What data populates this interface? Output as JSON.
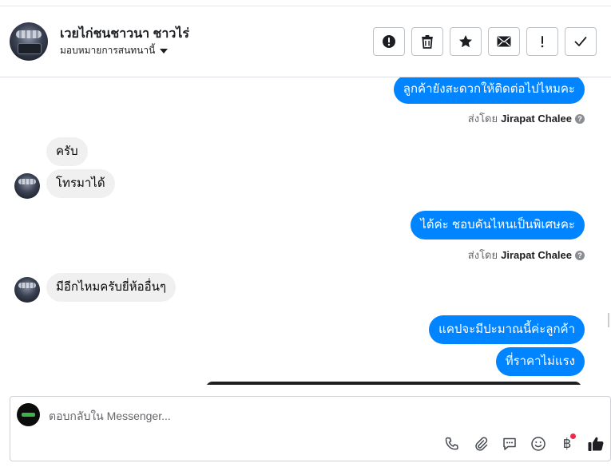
{
  "header": {
    "contact_name": "เวยไก่ชนชาวนา ชาวไร่",
    "assign_label": "มอบหมายการสนทนานี้"
  },
  "toolbar": {
    "buttons": [
      {
        "name": "mark-spam-button",
        "icon": "alert-circle-icon"
      },
      {
        "name": "delete-button",
        "icon": "trash-icon"
      },
      {
        "name": "star-button",
        "icon": "star-icon"
      },
      {
        "name": "mark-unread-button",
        "icon": "envelope-icon"
      },
      {
        "name": "follow-up-button",
        "icon": "exclamation-icon"
      },
      {
        "name": "mark-done-button",
        "icon": "check-icon"
      }
    ]
  },
  "messages": [
    {
      "direction": "out",
      "text": "ลูกค้ายังสะดวกให้ติดต่อไปไหมคะ",
      "sent_by_prefix": "ส่งโดย",
      "sent_by_name": "Jirapat Chalee"
    },
    {
      "direction": "in",
      "text": "ครับ"
    },
    {
      "direction": "in",
      "text": "โทรมาได้"
    },
    {
      "direction": "out",
      "text": "ได้ค่ะ ชอบคันไหนเป็นพิเศษคะ",
      "sent_by_prefix": "ส่งโดย",
      "sent_by_name": "Jirapat Chalee"
    },
    {
      "direction": "in",
      "text": "มีอีกไหมครับยี่ห้ออื่นๆ"
    },
    {
      "direction": "out",
      "text": "แคปจะมีปะมาณนี้ค่ะลูกค้า"
    },
    {
      "direction": "out",
      "text": "ที่ราคาไม่แรง"
    }
  ],
  "composer": {
    "placeholder": "ตอบกลับใน Messenger...",
    "currency_symbol": "฿",
    "tools": [
      "phone-icon",
      "paperclip-icon",
      "chat-bubble-icon",
      "emoji-icon",
      "baht-payment-icon",
      "thumbs-up-icon"
    ]
  },
  "colors": {
    "outgoing_bubble": "#0084ff",
    "incoming_bubble": "#f0f0f0",
    "notification_dot": "#f02849"
  }
}
